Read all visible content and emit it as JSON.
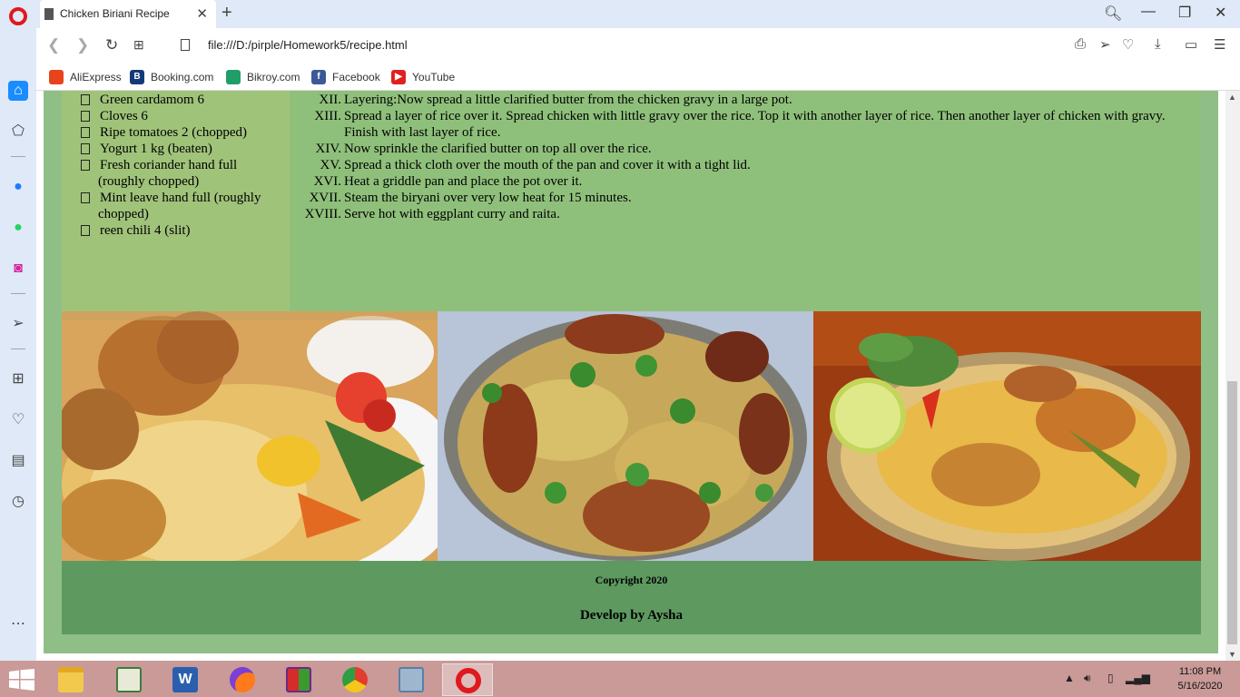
{
  "browser": {
    "tab_title": "Chicken Biriani Recipe",
    "url": "file:///D:/pirple/Homework5/recipe.html",
    "bookmarks": [
      {
        "label": "AliExpress",
        "icon": "aliexpress-icon",
        "color": "#e8431a"
      },
      {
        "label": "Booking.com",
        "icon": "booking-icon",
        "color": "#153a77"
      },
      {
        "label": "Bikroy.com",
        "icon": "bikroy-icon",
        "color": "#1f9e6a"
      },
      {
        "label": "Facebook",
        "icon": "facebook-icon",
        "color": "#3b5998"
      },
      {
        "label": "YouTube",
        "icon": "youtube-icon",
        "color": "#e02020"
      }
    ],
    "accent": "#e0191e"
  },
  "recipe": {
    "ingredients": [
      "Green cardamom 6",
      "Cloves 6",
      "Ripe tomatoes 2 (chopped)",
      "Yogurt 1 kg (beaten)",
      "Fresh coriander hand full (roughly chopped)",
      "Mint leave hand full (roughly chopped)",
      "reen chili 4 (slit)"
    ],
    "steps": [
      {
        "num": "XII.",
        "text": "Layering:Now spread a little clarified butter from the chicken gravy in a large pot."
      },
      {
        "num": "XIII.",
        "text": "Spread a layer of rice over it. Spread chicken with little gravy over the rice. Top it with another layer of rice. Then another layer of chicken with gravy. Finish with last layer of rice."
      },
      {
        "num": "XIV.",
        "text": "Now sprinkle the clarified butter on top all over the rice."
      },
      {
        "num": "XV.",
        "text": "Spread a thick cloth over the mouth of the pan and cover it with a tight lid."
      },
      {
        "num": "XVI.",
        "text": "Heat a griddle pan and place the pot over it."
      },
      {
        "num": "XVII.",
        "text": "Steam the biryani over very low heat for 15 minutes."
      },
      {
        "num": "XVIII.",
        "text": "Serve hot with eggplant curry and raita."
      }
    ],
    "photos": [
      "biryani-plate-photo",
      "chicken-biryani-tray-photo",
      "biryani-platter-photo"
    ],
    "footer": {
      "copyright": "Copyright 2020",
      "developer": "Develop by Aysha"
    },
    "colors": {
      "page_bg": "#8fbf86",
      "ingredients_bg": "#a0c37a",
      "steps_bg": "#8fc07b",
      "footer_bg": "#5e9960"
    }
  },
  "taskbar": {
    "apps": [
      "file-explorer-icon",
      "spreadsheet-app-icon",
      "word-icon",
      "firefox-icon",
      "winrar-icon",
      "chrome-icon",
      "network-app-icon",
      "opera-icon"
    ],
    "time": "11:08 PM",
    "date": "5/16/2020"
  }
}
